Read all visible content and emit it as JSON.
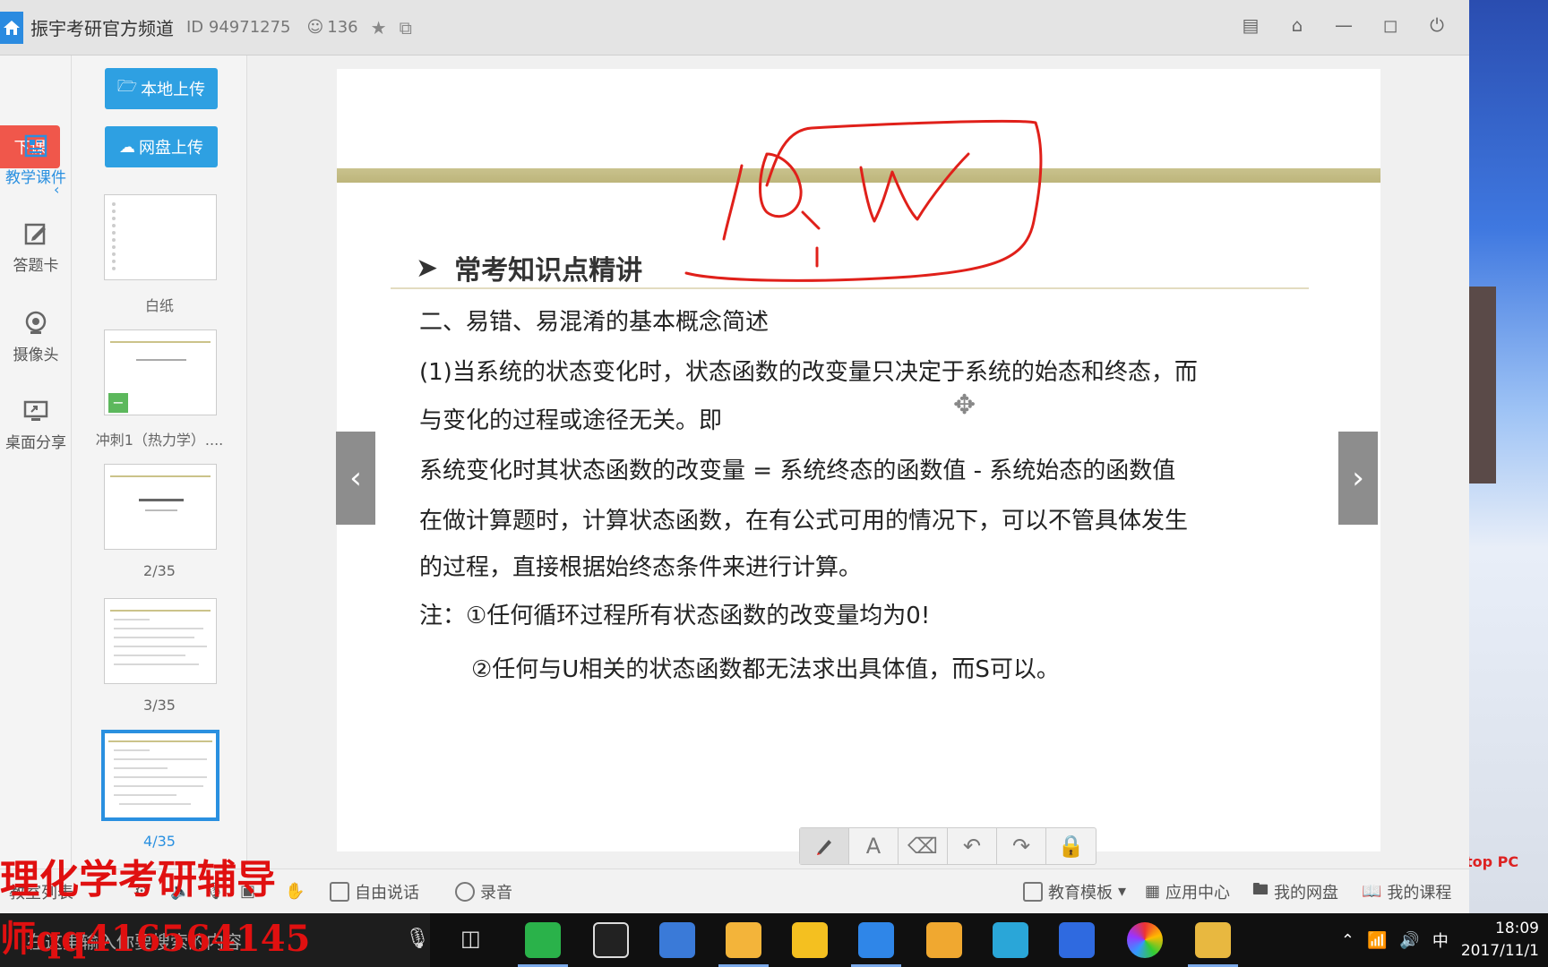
{
  "window": {
    "title": "振宇考研官方频道",
    "id_label": "ID 94971275",
    "viewer_count": "136"
  },
  "left_rail": {
    "end_class_label": "下课",
    "items": [
      {
        "label": "教学课件",
        "icon": "courseware-icon",
        "active": true
      },
      {
        "label": "答题卡",
        "icon": "answer-card-icon",
        "active": false
      },
      {
        "label": "摄像头",
        "icon": "camera-icon",
        "active": false
      },
      {
        "label": "桌面分享",
        "icon": "screen-share-icon",
        "active": false
      }
    ]
  },
  "slide_panel": {
    "local_upload": "本地上传",
    "cloud_upload": "网盘上传",
    "thumbnails": [
      {
        "label": "白纸"
      },
      {
        "label": "冲刺1（热力学）...."
      },
      {
        "label": "2/35"
      },
      {
        "label": "3/35"
      },
      {
        "label": "4/35",
        "active": true
      }
    ]
  },
  "slide": {
    "title": "常考知识点精讲",
    "line1": "二、易错、易混淆的基本概念简述",
    "line2": "(1)当系统的状态变化时，状态函数的改变量只决定于系统的始态和终态，而",
    "line3": "与变化的过程或途径无关。即",
    "line4": "系统变化时其状态函数的改变量 = 系统终态的函数值 - 系统始态的函数值",
    "line5": "在做计算题时，计算状态函数，在有公式可用的情况下，可以不管具体发生",
    "line6": "的过程，直接根据始终态条件来进行计算。",
    "line7": "注：①任何循环过程所有状态函数的改变量均为0!",
    "line8": "②任何与U相关的状态函数都无法求出具体值，而S可以。",
    "accent_color": "#c4bc85",
    "annotation_color": "#e0201a"
  },
  "bottom_bar": {
    "room_list": "教室列表",
    "free_talk": "自由说话",
    "record": "录音",
    "edu_template": "教育模板",
    "app_center": "应用中心",
    "my_cloud": "我的网盘",
    "my_course": "我的课程"
  },
  "watermark": {
    "line1": "理化学考研辅导",
    "line2": "师qq416564145"
  },
  "desktop": {
    "partial_text": "top PC"
  },
  "taskbar": {
    "search_placeholder": "在这里输入你要搜索的内容",
    "ime": "中",
    "time": "18:09",
    "date": "2017/11/1"
  }
}
